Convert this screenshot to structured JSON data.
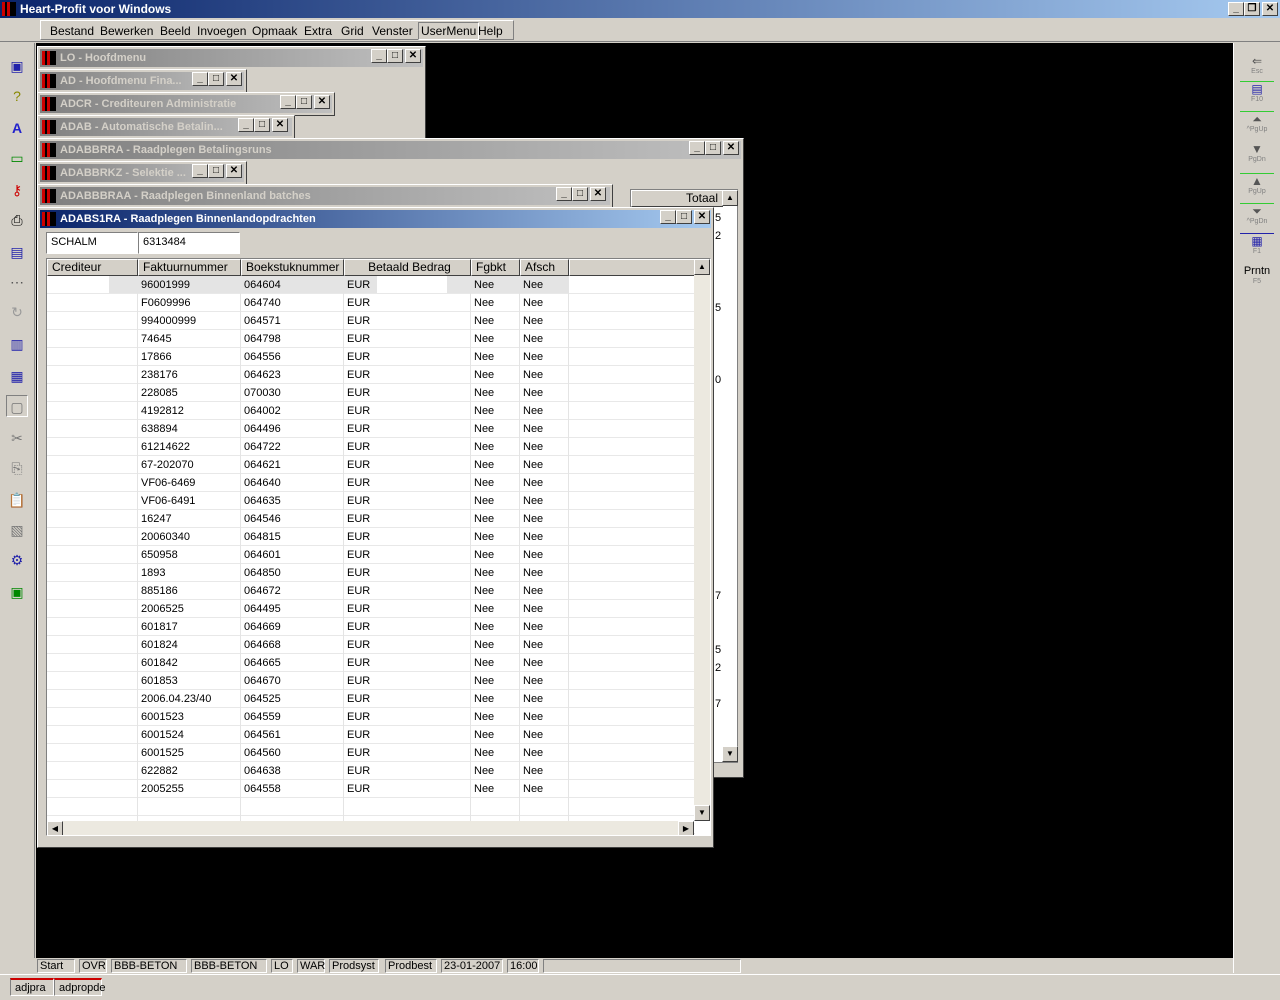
{
  "app": {
    "title": "Heart-Profit voor Windows"
  },
  "menu": [
    "Bestand",
    "Bewerken",
    "Beeld",
    "Invoegen",
    "Opmaak",
    "Extra",
    "Grid",
    "Venster",
    "UserMenu",
    "Help"
  ],
  "windows": {
    "w1": "LO - Hoofdmenu",
    "w2": "AD - Hoofdmenu Fina...",
    "w3": "ADCR - Crediteuren Administratie",
    "w4": "ADAB - Automatische Betalin...",
    "w5": "ADABBRRA - Raadplegen Betalingsruns",
    "w6": "ADABBRKZ - Selektie ...",
    "w7": "ADABBBRAA - Raadplegen Binnenland batches",
    "w8": "ADABS1RA - Raadplegen Binnenlandopdrachten"
  },
  "back_grid": {
    "header": "Totaal",
    "edge_digits": [
      "5",
      "2",
      "5",
      "0",
      "7",
      "5",
      "2",
      "7"
    ]
  },
  "filter": {
    "crediteur": "SCHALM",
    "nummer": "6313484"
  },
  "columns": [
    "Crediteur",
    "Faktuurnummer",
    "Boekstuknummer",
    "Betaald Bedrag",
    "Fgbkt",
    "Afsch"
  ],
  "rows": [
    {
      "crediteur": "",
      "faktuur": "96001999",
      "boekstuk": "064604",
      "valuta": "EUR",
      "fgbkt": "Nee",
      "afsch": "Nee"
    },
    {
      "crediteur": "",
      "faktuur": "F0609996",
      "boekstuk": "064740",
      "valuta": "EUR",
      "fgbkt": "Nee",
      "afsch": "Nee"
    },
    {
      "crediteur": "",
      "faktuur": "994000999",
      "boekstuk": "064571",
      "valuta": "EUR",
      "fgbkt": "Nee",
      "afsch": "Nee"
    },
    {
      "crediteur": "",
      "faktuur": "74645",
      "boekstuk": "064798",
      "valuta": "EUR",
      "fgbkt": "Nee",
      "afsch": "Nee"
    },
    {
      "crediteur": "",
      "faktuur": "17866",
      "boekstuk": "064556",
      "valuta": "EUR",
      "fgbkt": "Nee",
      "afsch": "Nee"
    },
    {
      "crediteur": "",
      "faktuur": "238176",
      "boekstuk": "064623",
      "valuta": "EUR",
      "fgbkt": "Nee",
      "afsch": "Nee"
    },
    {
      "crediteur": "",
      "faktuur": "228085",
      "boekstuk": "070030",
      "valuta": "EUR",
      "fgbkt": "Nee",
      "afsch": "Nee"
    },
    {
      "crediteur": "",
      "faktuur": "4192812",
      "boekstuk": "064002",
      "valuta": "EUR",
      "fgbkt": "Nee",
      "afsch": "Nee"
    },
    {
      "crediteur": "",
      "faktuur": "638894",
      "boekstuk": "064496",
      "valuta": "EUR",
      "fgbkt": "Nee",
      "afsch": "Nee"
    },
    {
      "crediteur": "",
      "faktuur": "61214622",
      "boekstuk": "064722",
      "valuta": "EUR",
      "fgbkt": "Nee",
      "afsch": "Nee"
    },
    {
      "crediteur": "",
      "faktuur": "67-202070",
      "boekstuk": "064621",
      "valuta": "EUR",
      "fgbkt": "Nee",
      "afsch": "Nee"
    },
    {
      "crediteur": "",
      "faktuur": "VF06-6469",
      "boekstuk": "064640",
      "valuta": "EUR",
      "fgbkt": "Nee",
      "afsch": "Nee"
    },
    {
      "crediteur": "",
      "faktuur": "VF06-6491",
      "boekstuk": "064635",
      "valuta": "EUR",
      "fgbkt": "Nee",
      "afsch": "Nee"
    },
    {
      "crediteur": "",
      "faktuur": "16247",
      "boekstuk": "064546",
      "valuta": "EUR",
      "fgbkt": "Nee",
      "afsch": "Nee"
    },
    {
      "crediteur": "",
      "faktuur": "20060340",
      "boekstuk": "064815",
      "valuta": "EUR",
      "fgbkt": "Nee",
      "afsch": "Nee"
    },
    {
      "crediteur": "",
      "faktuur": "650958",
      "boekstuk": "064601",
      "valuta": "EUR",
      "fgbkt": "Nee",
      "afsch": "Nee"
    },
    {
      "crediteur": "",
      "faktuur": "1893",
      "boekstuk": "064850",
      "valuta": "EUR",
      "fgbkt": "Nee",
      "afsch": "Nee"
    },
    {
      "crediteur": "",
      "faktuur": "885186",
      "boekstuk": "064672",
      "valuta": "EUR",
      "fgbkt": "Nee",
      "afsch": "Nee"
    },
    {
      "crediteur": "",
      "faktuur": "2006525",
      "boekstuk": "064495",
      "valuta": "EUR",
      "fgbkt": "Nee",
      "afsch": "Nee"
    },
    {
      "crediteur": "",
      "faktuur": "601817",
      "boekstuk": "064669",
      "valuta": "EUR",
      "fgbkt": "Nee",
      "afsch": "Nee"
    },
    {
      "crediteur": "",
      "faktuur": "601824",
      "boekstuk": "064668",
      "valuta": "EUR",
      "fgbkt": "Nee",
      "afsch": "Nee"
    },
    {
      "crediteur": "",
      "faktuur": "601842",
      "boekstuk": "064665",
      "valuta": "EUR",
      "fgbkt": "Nee",
      "afsch": "Nee"
    },
    {
      "crediteur": "",
      "faktuur": "601853",
      "boekstuk": "064670",
      "valuta": "EUR",
      "fgbkt": "Nee",
      "afsch": "Nee"
    },
    {
      "crediteur": "",
      "faktuur": "2006.04.23/40",
      "boekstuk": "064525",
      "valuta": "EUR",
      "fgbkt": "Nee",
      "afsch": "Nee"
    },
    {
      "crediteur": "",
      "faktuur": "6001523",
      "boekstuk": "064559",
      "valuta": "EUR",
      "fgbkt": "Nee",
      "afsch": "Nee"
    },
    {
      "crediteur": "",
      "faktuur": "6001524",
      "boekstuk": "064561",
      "valuta": "EUR",
      "fgbkt": "Nee",
      "afsch": "Nee"
    },
    {
      "crediteur": "",
      "faktuur": "6001525",
      "boekstuk": "064560",
      "valuta": "EUR",
      "fgbkt": "Nee",
      "afsch": "Nee"
    },
    {
      "crediteur": "",
      "faktuur": "622882",
      "boekstuk": "064638",
      "valuta": "EUR",
      "fgbkt": "Nee",
      "afsch": "Nee"
    },
    {
      "crediteur": "",
      "faktuur": "2005255",
      "boekstuk": "064558",
      "valuta": "EUR",
      "fgbkt": "Nee",
      "afsch": "Nee"
    }
  ],
  "right_toolbar": [
    {
      "glyph": "⇐",
      "key": "Esc"
    },
    {
      "glyph": "▤",
      "key": "F10"
    },
    {
      "glyph": "⏶",
      "key": "^PgUp"
    },
    {
      "glyph": "▼",
      "key": "PgDn"
    },
    {
      "glyph": "▲",
      "key": "PgUp"
    },
    {
      "glyph": "⏷",
      "key": "^PgDn"
    },
    {
      "glyph": "▦",
      "key": "F1"
    },
    {
      "glyph": "Prntn",
      "key": "F5"
    }
  ],
  "status": {
    "start": "Start",
    "mode": "OVR",
    "company1": "BBB-BETON",
    "company2": "BBB-BETON",
    "module": "LO",
    "war": "WAR",
    "prodsyst": "Prodsyst",
    "prodbest": "Prodbest",
    "date": "23-01-2007",
    "time": "16:00"
  },
  "taskbar": [
    "adjpra",
    "adpropde"
  ],
  "colors": {
    "active_title": "#0a246a",
    "inactive_title": "#808080",
    "face": "#d4d0c8",
    "highlight_row": "#e0e0e0"
  }
}
